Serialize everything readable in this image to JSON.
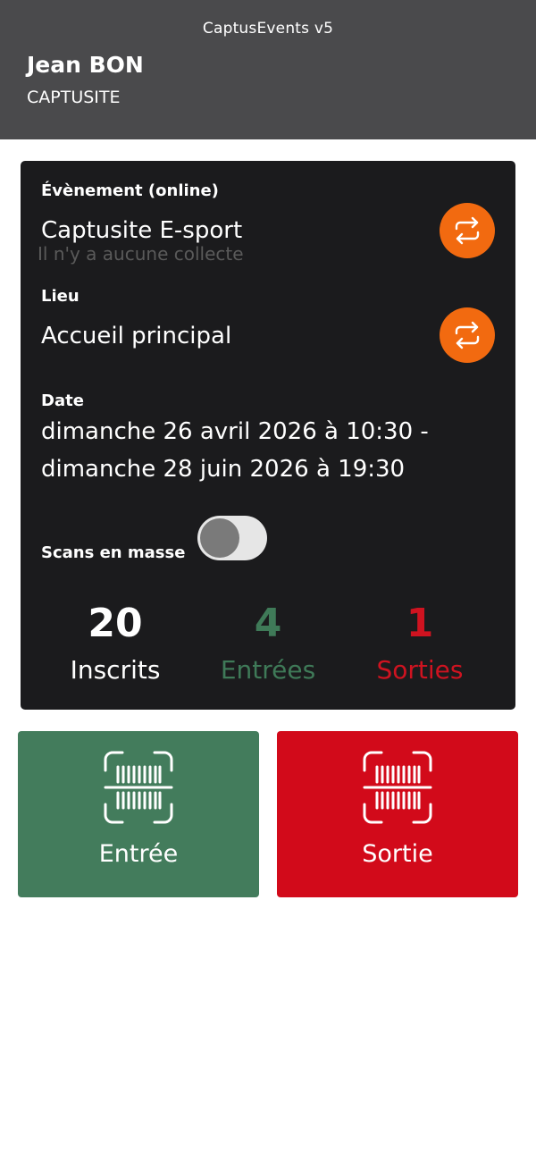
{
  "app": {
    "title": "CaptusEvents v5"
  },
  "user": {
    "name": "Jean BON",
    "company": "CAPTUSITE"
  },
  "event": {
    "label": "Évènement (online)",
    "value": "Captusite E-sport",
    "empty_message": "Il n'y a aucune collecte",
    "change_icon": "sync-icon"
  },
  "location": {
    "label": "Lieu",
    "value": "Accueil principal",
    "change_icon": "sync-icon"
  },
  "date": {
    "label": "Date",
    "line1": "dimanche 26 avril 2026 à 10:30 -",
    "line2": "dimanche 28 juin 2026 à 19:30"
  },
  "bulk_scan": {
    "label": "Scans en masse",
    "enabled": false
  },
  "stats": {
    "registered": {
      "value": "20",
      "label": "Inscrits",
      "color": "#ffffff"
    },
    "entries": {
      "value": "4",
      "label": "Entrées",
      "color": "#3f7a58"
    },
    "exits": {
      "value": "1",
      "label": "Sorties",
      "color": "#cf1320"
    }
  },
  "actions": {
    "entry": {
      "label": "Entrée",
      "color": "#437c5c",
      "icon": "barcode-scan-icon"
    },
    "exit": {
      "label": "Sortie",
      "color": "#d20a1a",
      "icon": "barcode-scan-icon"
    }
  },
  "colors": {
    "header": "#4a4a4c",
    "card": "#1b1b1d",
    "accent": "#f26a10"
  }
}
